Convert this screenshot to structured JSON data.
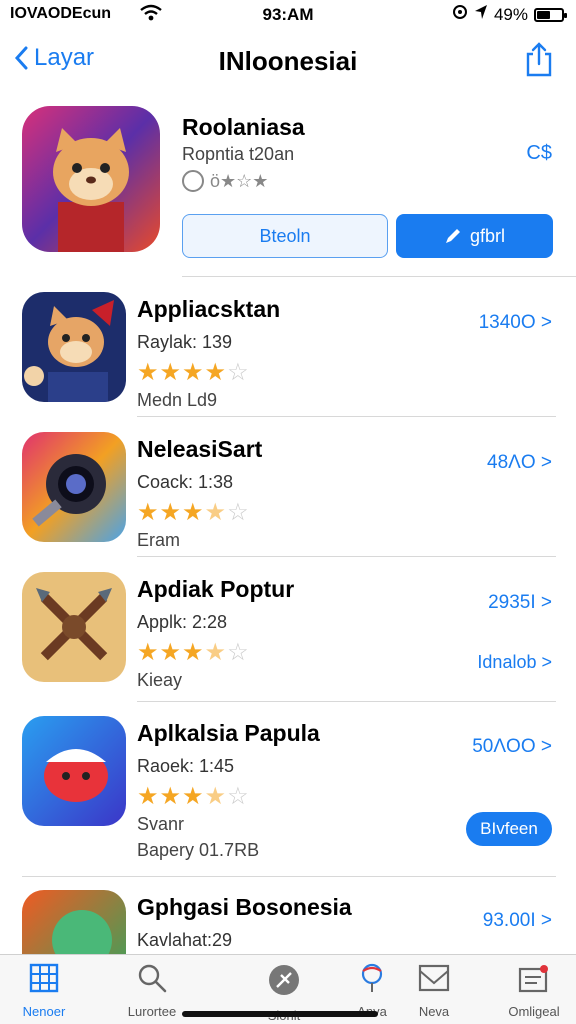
{
  "status": {
    "carrier": "IOVAODEcun",
    "time": "93:AM",
    "battery": "49%",
    "battery_level": 0.49
  },
  "nav": {
    "back_label": "Layar",
    "title": "INloonesiai"
  },
  "featured": {
    "title": "Roolaniasa",
    "subtitle": "Ropntia t20an",
    "price": "C$",
    "rating_text": "ö★☆★",
    "btn_left": "Bteoln",
    "btn_right": "gfbrl"
  },
  "apps": [
    {
      "title": "Appliacsktan",
      "line2": "Raylak: 139",
      "line3": "Medn Ld9",
      "price": "1340O >",
      "rating": 4
    },
    {
      "title": "NeleasiSart",
      "line2": "Coack: 1:38",
      "line3": "Eram",
      "price": "48ΛO >",
      "rating": 3.5
    },
    {
      "title": "Apdiak Poptur",
      "line2": "Applk: 2:28",
      "line3": "Kieay",
      "price": "2935I >",
      "link2": "Idnalob >",
      "rating": 3.5
    },
    {
      "title": "Aplkalsia Papula",
      "line2": "Raoek: 1:45",
      "line3": "Svanr",
      "line4": "Bapery 01.7RB",
      "price": "50ΛOO >",
      "pill": "BIvfeen",
      "rating": 3.5
    },
    {
      "title": "Gphgasi Bosonesia",
      "line2": "Kavlahat:29",
      "price": "93.00I >"
    }
  ],
  "tabs": [
    {
      "label": "Nenoer"
    },
    {
      "label": "Lurortee"
    },
    {
      "label": "Sionit"
    },
    {
      "label": "Anva"
    },
    {
      "label": "Neva"
    },
    {
      "label": "Omligeal"
    }
  ],
  "colors": {
    "accent": "#1a7cf0",
    "star": "#f5a623"
  }
}
